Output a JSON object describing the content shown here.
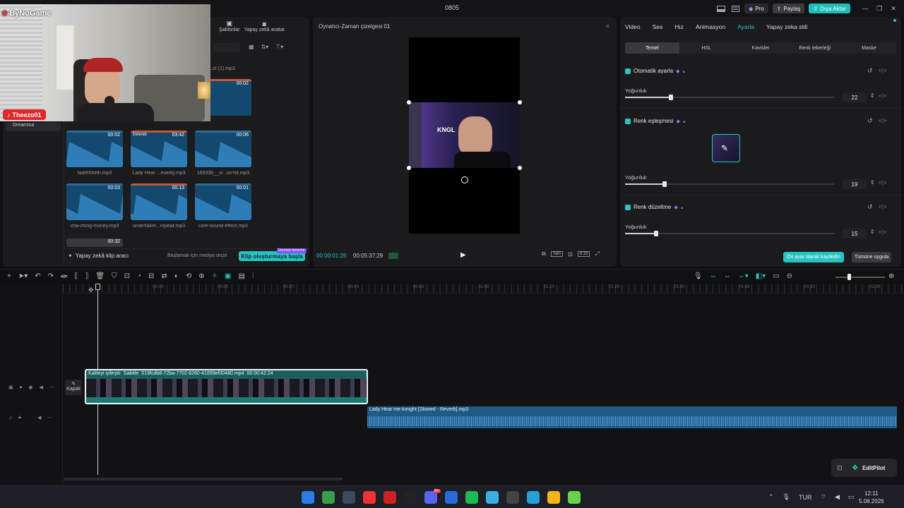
{
  "app": {
    "title": "0805"
  },
  "titlebar": {
    "pro": "Pro",
    "share": "Paylaş",
    "export": "Dışa Aktar"
  },
  "overlay": {
    "channel": "ByNoGame",
    "streamer": "Theezo01"
  },
  "media": {
    "tabs": [
      "Şablonlar",
      "Yapay zekâ avatar"
    ],
    "sidebar_item": "Dreamina",
    "top_names": [
      "...ound...ct (1).mp3"
    ],
    "items": [
      {
        "name": "faahhhhhh.mp3",
        "dur": "00:02",
        "tag": ""
      },
      {
        "name": "Lady Hear ...everb].mp3",
        "dur": "03:42",
        "tag": "Eklendi"
      },
      {
        "name": "169335__vi...ss-hit.mp3",
        "dur": "00:06",
        "tag": ""
      },
      {
        "name": "cha-ching-money.mp3",
        "dur": "00:03",
        "tag": ""
      },
      {
        "name": "undertaker...repeat.mp3",
        "dur": "00:13",
        "tag": ""
      },
      {
        "name": "core-sound-effect.mp3",
        "dur": "00:01",
        "tag": ""
      }
    ],
    "top_right_dur": "00:02",
    "bottom_partial_dur": "00:32",
    "ai_clip_tool": "Yapay zekâ klip aracı",
    "hint": "Başlamak için medya seçin",
    "clip_button": "Klip oluşturmaya başla",
    "badge": "Ücretsiz deneme"
  },
  "player": {
    "title": "Oynatıcı-Zaman çizelgesi 01",
    "current_time": "00:00:01:26",
    "total_time": "00:05:37:29",
    "full_label": "Tam",
    "ratio": "9:16"
  },
  "inspector": {
    "tabs": [
      "Video",
      "Ses",
      "Hız",
      "Animasyon",
      "Ayarla",
      "Yapay zeka stili"
    ],
    "active_tab": "Ayarla",
    "subtabs": [
      "Temel",
      "HSL",
      "Kavisler",
      "Renk tekerleği",
      "Maske"
    ],
    "sections": [
      {
        "title": "Otomatik ayarla",
        "label": "Yoğunluk",
        "value": "22",
        "fraction": 0.22
      },
      {
        "title": "Renk eşleşmesi",
        "label": "Yoğunluk",
        "value": "19",
        "fraction": 0.19
      },
      {
        "title": "Renk düzeltme",
        "label": "Yoğunluk",
        "value": "15",
        "fraction": 0.15
      }
    ],
    "save_preset": "Ön ayar olarak kaydedin",
    "apply_all": "Tümüne uygula"
  },
  "timeline": {
    "ruler": [
      "00:10",
      "00:20",
      "00:30",
      "00:40",
      "00:50",
      "01:00",
      "01:10",
      "01:20",
      "01:30",
      "01:40",
      "01:50",
      "02:00"
    ],
    "cover": "Kapak",
    "video_clip": {
      "tags": [
        "Kaliteyi iyileştir",
        "Sabitle"
      ],
      "file": "019fcdb8-72ba-7702-8260-41899ef00480.mp4",
      "duration": "00:00:42:24"
    },
    "audio_clip": "Lady Hear me tonight [Slowed - Reverb].mp3",
    "editpilot": "EditPilot"
  },
  "taskbar": {
    "lang": "TUR",
    "time": "12:11",
    "date": "5.08.2026",
    "badge": "99+"
  },
  "colors": {
    "accent": "#27c3c3",
    "bg": "#101012",
    "panel": "#1b1b1e",
    "audio": "#1f5a86",
    "video_border": "#3fe0d8"
  }
}
